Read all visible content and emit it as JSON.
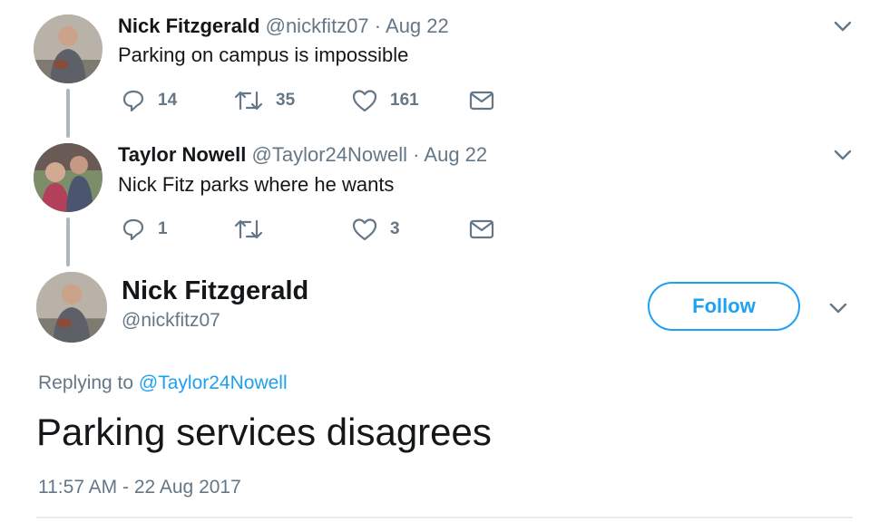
{
  "tweets": [
    {
      "name": "Nick Fitzgerald",
      "handle": "@nickfitz07",
      "date": "Aug 22",
      "text": "Parking on campus is impossible",
      "replies": "14",
      "retweets": "35",
      "likes": "161"
    },
    {
      "name": "Taylor Nowell",
      "handle": "@Taylor24Nowell",
      "date": "Aug 22",
      "text": "Nick Fitz parks where he wants",
      "replies": "1",
      "retweets": "",
      "likes": "3"
    }
  ],
  "separator": "·",
  "main_tweet": {
    "name": "Nick Fitzgerald",
    "handle": "@nickfitz07",
    "follow_label": "Follow",
    "replying_prefix": "Replying to",
    "replying_to": "@Taylor24Nowell",
    "text": "Parking services disagrees",
    "timestamp": "11:57 AM - 22 Aug 2017"
  },
  "icons": [
    "reply-icon",
    "retweet-icon",
    "like-icon",
    "direct-message-icon",
    "chevron-down-icon",
    "avatar"
  ],
  "colors": {
    "accent": "#1da1f2",
    "secondary_text": "#657786",
    "primary_text": "#14171a",
    "thread_line": "#aab8c2"
  }
}
